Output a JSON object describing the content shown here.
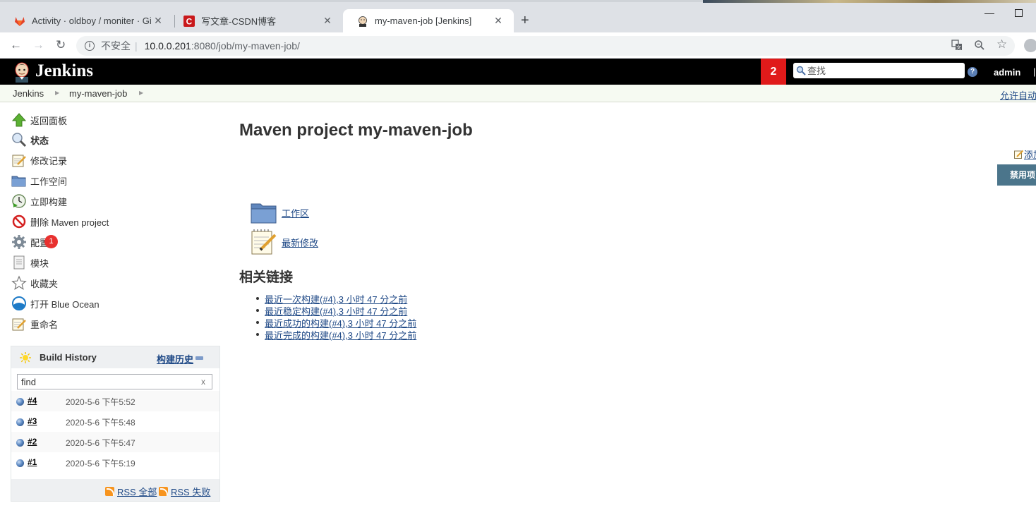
{
  "browser": {
    "tabs": [
      {
        "title": "Activity · oldboy / moniter · Gi",
        "active": false
      },
      {
        "title": "写文章-CSDN博客",
        "active": false
      },
      {
        "title": "my-maven-job [Jenkins]",
        "active": true
      }
    ],
    "address": {
      "insecure": "不安全",
      "host": "10.0.0.201",
      "path": ":8080/job/my-maven-job/"
    }
  },
  "header": {
    "logo_text": "Jenkins",
    "notification_count": "2",
    "search_placeholder": "查找",
    "help": "?",
    "user": "admin",
    "separator": "|"
  },
  "breadcrumb": {
    "items": [
      "Jenkins",
      "my-maven-job"
    ],
    "auto_refresh": "允许自动刷新"
  },
  "tasks": [
    {
      "label": "返回面板",
      "icon": "up-arrow-icon"
    },
    {
      "label": "状态",
      "icon": "magnifier-icon",
      "bold": true
    },
    {
      "label": "修改记录",
      "icon": "notepad-icon"
    },
    {
      "label": "工作空间",
      "icon": "folder-icon"
    },
    {
      "label": "立即构建",
      "icon": "clock-play-icon"
    },
    {
      "label": "删除 Maven project",
      "icon": "no-entry-icon"
    },
    {
      "label": "配置",
      "icon": "gear-icon"
    },
    {
      "label": "模块",
      "icon": "document-icon"
    },
    {
      "label": "收藏夹",
      "icon": "star-icon"
    },
    {
      "label": "打开 Blue Ocean",
      "icon": "blue-ocean-icon"
    },
    {
      "label": "重命名",
      "icon": "notepad-icon"
    }
  ],
  "config_badge": "1",
  "build_history": {
    "title": "Build History",
    "trend_link": "构建历史",
    "filter_placeholder": "find",
    "clear": "x",
    "builds": [
      {
        "number": "#4",
        "date": "2020-5-6 下午5:52"
      },
      {
        "number": "#3",
        "date": "2020-5-6 下午5:48"
      },
      {
        "number": "#2",
        "date": "2020-5-6 下午5:47"
      },
      {
        "number": "#1",
        "date": "2020-5-6 下午5:19"
      }
    ],
    "rss_all": "RSS 全部",
    "rss_failed": "RSS 失败"
  },
  "main": {
    "title": "Maven project my-maven-job",
    "add_description": "添加描述",
    "disable_button": "禁用项目",
    "workspace_link": "工作区",
    "changes_link": "最新修改",
    "related_title": "相关链接",
    "permalinks": [
      "最近一次构建(#4),3 小时 47 分之前",
      "最近稳定构建(#4),3 小时 47 分之前",
      "最近成功的构建(#4),3 小时 47 分之前",
      "最近完成的构建(#4),3 小时 47 分之前"
    ]
  },
  "colors": {
    "link": "#204a87",
    "header": "#000000",
    "notification": "#e01a1a",
    "disable_button": "#4b758b"
  }
}
